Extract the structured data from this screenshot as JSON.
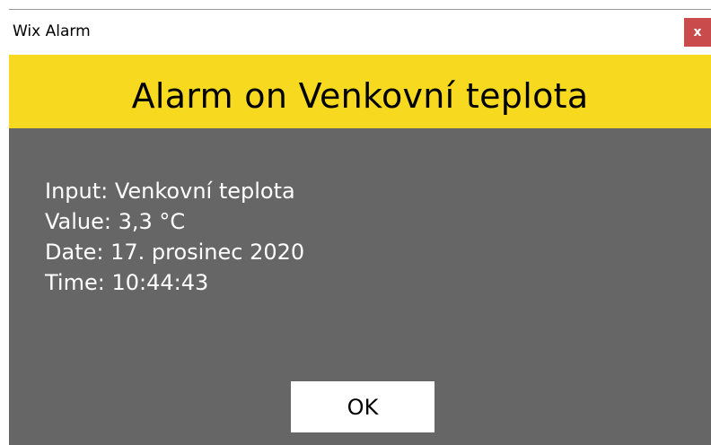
{
  "window": {
    "title": "Wix Alarm",
    "close_label": "x"
  },
  "banner": {
    "text": "Alarm on Venkovní teplota"
  },
  "info": {
    "input": "Input: Venkovní teplota",
    "value": "Value: 3,3 °C",
    "date": "Date: 17. prosinec 2020",
    "time": "Time: 10:44:43"
  },
  "actions": {
    "ok_label": "OK"
  },
  "colors": {
    "banner": "#f7d91f",
    "content": "#666666",
    "close": "#c94b4b"
  }
}
